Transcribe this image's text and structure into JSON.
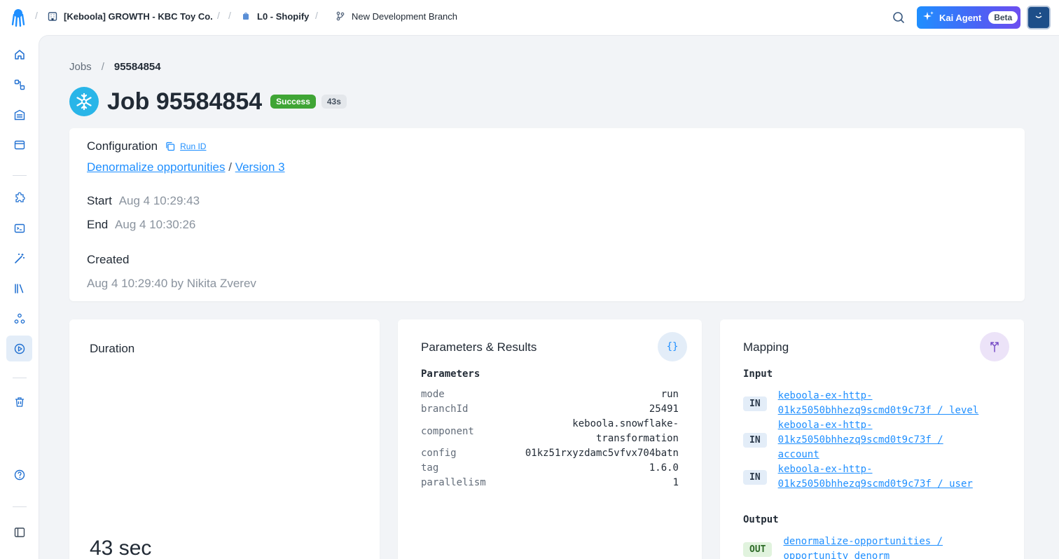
{
  "topbar": {
    "project": "[Keboola] GROWTH - KBC Toy Co.",
    "component": "L0 - Shopify",
    "branch": "New Development Branch",
    "kai_label": "Kai Agent",
    "kai_badge": "Beta"
  },
  "breadcrumb": {
    "parent": "Jobs",
    "sep": "/",
    "current": "95584854"
  },
  "job": {
    "title": "Job 95584854",
    "status": "Success",
    "duration_badge": "43s"
  },
  "configuration": {
    "heading": "Configuration",
    "run_id_label": "Run ID",
    "config_name": "Denormalize opportunities",
    "link_sep": "/",
    "version": "Version 3",
    "start_label": "Start",
    "start_value": "Aug 4 10:29:43",
    "end_label": "End",
    "end_value": "Aug 4 10:30:26",
    "created_label": "Created",
    "created_value": "Aug 4 10:29:40 by Nikita Zverev"
  },
  "duration": {
    "heading": "Duration",
    "value": "43 sec"
  },
  "parameters": {
    "heading": "Parameters & Results",
    "sub_heading": "Parameters",
    "rows": [
      {
        "key": "mode",
        "value": "run"
      },
      {
        "key": "branchId",
        "value": "25491"
      },
      {
        "key": "component",
        "value": "keboola.snowflake-\ntransformation"
      },
      {
        "key": "config",
        "value": "01kz51rxyzdamc5vfvx704batn"
      },
      {
        "key": "tag",
        "value": "1.6.0"
      },
      {
        "key": "parallelism",
        "value": "1"
      }
    ]
  },
  "mapping": {
    "heading": "Mapping",
    "input_heading": "Input",
    "output_heading": "Output",
    "inputs": [
      {
        "tag": "IN",
        "line1": "keboola-ex-http-",
        "line2": "01kz5050bhhezq9scmd0t9c73f / level",
        "line3": ""
      },
      {
        "tag": "IN",
        "line1": "keboola-ex-http-",
        "line2": "01kz5050bhhezq9scmd0t9c73f /",
        "line3": "account"
      },
      {
        "tag": "IN",
        "line1": "keboola-ex-http-",
        "line2": "01kz5050bhhezq9scmd0t9c73f / user",
        "line3": ""
      }
    ],
    "outputs": [
      {
        "tag": "OUT",
        "line1": "denormalize-opportunities /",
        "line2": "opportunity_denorm"
      }
    ]
  },
  "colors": {
    "accent": "#1f8fff",
    "success": "#3fa535",
    "snowflake": "#29b5e8"
  }
}
